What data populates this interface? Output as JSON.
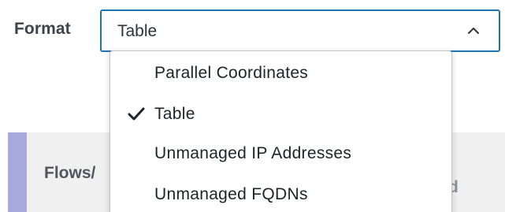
{
  "format_field": {
    "label": "Format",
    "selected_value": "Table",
    "expanded": true,
    "chevron_icon": "chevron-up-icon",
    "border_color": "#2271b1"
  },
  "dropdown": {
    "options": [
      {
        "label": "Parallel Coordinates",
        "selected": false
      },
      {
        "label": "Table",
        "selected": true
      },
      {
        "label": "Unmanaged IP Addresses",
        "selected": false
      },
      {
        "label": "Unmanaged FQDNs",
        "selected": false
      }
    ],
    "check_icon": "checkmark-icon"
  },
  "background": {
    "heading_left": "Flows/",
    "heading_right": "d",
    "accent_color": "#a7aadc"
  }
}
